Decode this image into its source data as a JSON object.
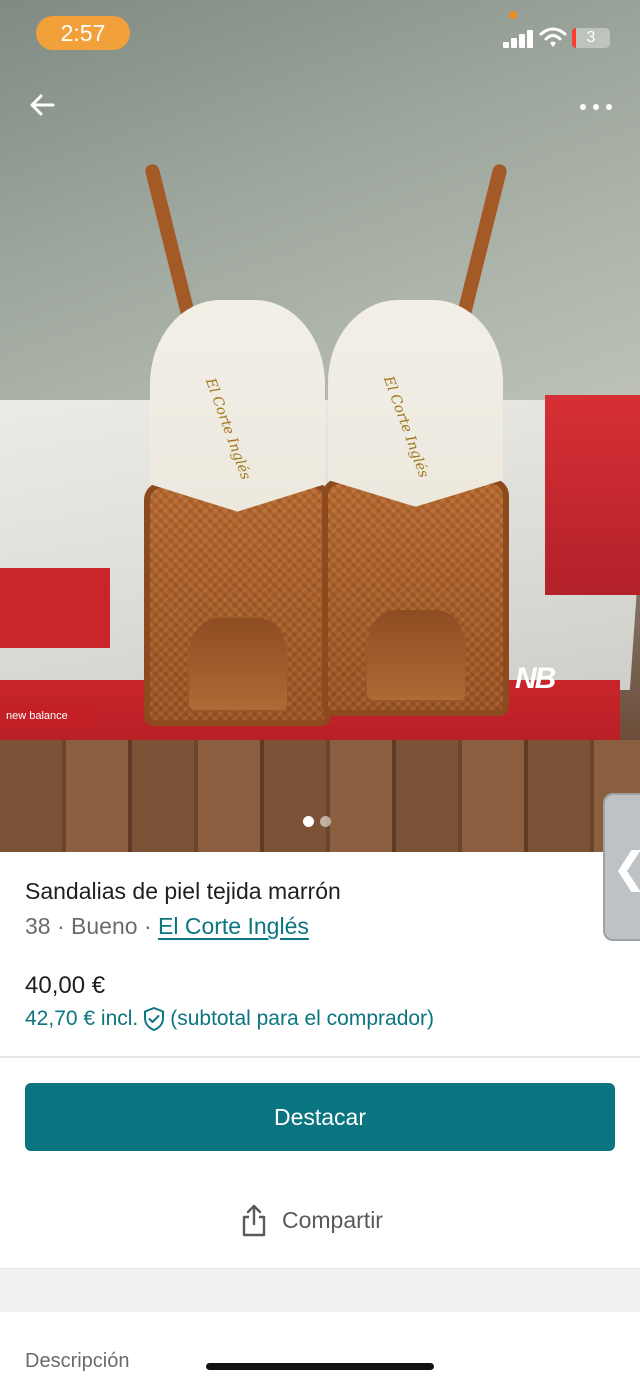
{
  "status_bar": {
    "time": "2:57",
    "battery_level": "3"
  },
  "gallery": {
    "total_images": 2,
    "active_index": 0,
    "printed_box_text": "new balance",
    "printed_logo_text": "NB",
    "insole_text": "El Corte Inglés"
  },
  "item": {
    "title": "Sandalias de piel tejida marrón",
    "size": "38",
    "separator": "·",
    "condition": "Bueno",
    "brand": "El Corte Inglés",
    "price": "40,00 €",
    "price_incl": "42,70 € incl.",
    "price_incl_note": "(subtotal para el comprador)"
  },
  "actions": {
    "highlight_label": "Destacar",
    "share_label": "Compartir"
  },
  "sections": {
    "description_label": "Descripción"
  },
  "colors": {
    "accent": "#097580",
    "link": "#0b7580",
    "time_pill": "#f2a03a"
  },
  "icons": {
    "back": "arrow-left-icon",
    "more": "more-horizontal-icon",
    "shield": "shield-check-icon",
    "share": "share-icon",
    "side_tab": "chevron-left-icon"
  }
}
